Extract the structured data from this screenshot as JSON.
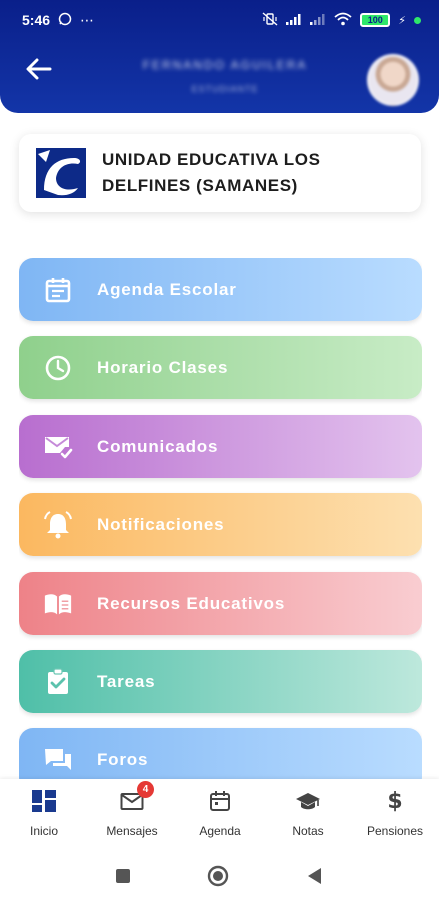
{
  "status_bar": {
    "time": "5:46",
    "left_icons": [
      "whatsapp-icon",
      "more-dots-icon"
    ],
    "right_icons": [
      "vibrate-off-icon",
      "signal-icon",
      "signal-icon",
      "wifi-icon",
      "battery-icon"
    ],
    "battery": "100"
  },
  "header": {
    "back_icon": "arrow-left-icon",
    "profile_name": "FERNANDO AGUILERA",
    "profile_role": "ESTUDIANTE"
  },
  "school": {
    "name": "UNIDAD EDUCATIVA LOS DELFINES (SAMANES)"
  },
  "menu": {
    "items": [
      {
        "label": "Agenda Escolar",
        "icon": "calendar-icon",
        "colors": [
          "#7fb6f4",
          "#b9dcff"
        ]
      },
      {
        "label": "Horario Clases",
        "icon": "clock-icon",
        "colors": [
          "#8fd08c",
          "#c8ecc6"
        ]
      },
      {
        "label": "Comunicados",
        "icon": "mail-check-icon",
        "colors": [
          "#b86ecf",
          "#e3c3ee"
        ]
      },
      {
        "label": "Notificaciones",
        "icon": "bell-icon",
        "colors": [
          "#fbb860",
          "#fde0b0"
        ]
      },
      {
        "label": "Recursos Educativos",
        "icon": "book-icon",
        "colors": [
          "#ee8288",
          "#f9cdd1"
        ]
      },
      {
        "label": "Tareas",
        "icon": "clipboard-check-icon",
        "colors": [
          "#4fbfa8",
          "#bde8dc"
        ]
      },
      {
        "label": "Foros",
        "icon": "forum-icon",
        "colors": [
          "#7fb6f4",
          "#b9dcff"
        ]
      }
    ]
  },
  "bottom_nav": {
    "items": [
      {
        "label": "Inicio",
        "icon": "dashboard-icon",
        "active": true
      },
      {
        "label": "Mensajes",
        "icon": "envelope-icon",
        "badge": "4"
      },
      {
        "label": "Agenda",
        "icon": "calendar-icon"
      },
      {
        "label": "Notas",
        "icon": "graduation-cap-icon"
      },
      {
        "label": "Pensiones",
        "icon": "dollar-icon"
      }
    ]
  },
  "colors": {
    "header": "#0a1f8a",
    "active_nav": "#1a3a8f",
    "badge": "#e53935"
  }
}
